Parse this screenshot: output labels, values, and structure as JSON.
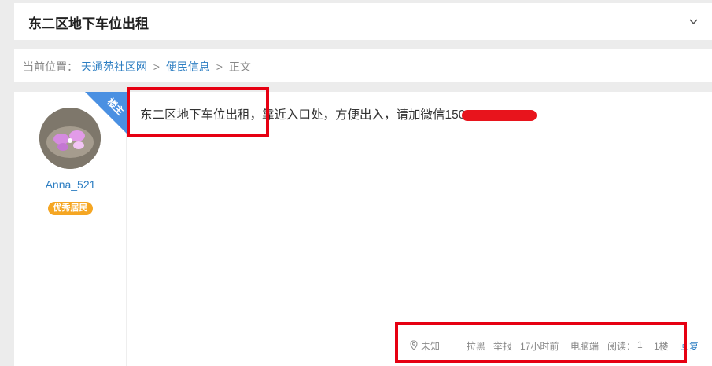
{
  "header": {
    "title": "东二区地下车位出租"
  },
  "breadcrumb": {
    "prefix": "当前位置：",
    "items": [
      "天通苑社区网",
      "便民信息",
      "正文"
    ],
    "separator": ">"
  },
  "post": {
    "author": {
      "name": "Anna_521",
      "badge": "优秀居民"
    },
    "op_label": "楼主",
    "content": "东二区地下车位出租，靠近入口处，方便出入，请加微信150",
    "meta": {
      "location": "未知",
      "block": "拉黑",
      "report": "举报",
      "time": "17小时前",
      "device": "电脑端",
      "views_label": "阅读：",
      "views": "1",
      "floor": "1楼",
      "reply": "回复"
    }
  },
  "colors": {
    "link": "#2d7ec2",
    "badge": "#f5a623",
    "highlight": "#e60012",
    "ribbon": "#4a90e2"
  }
}
